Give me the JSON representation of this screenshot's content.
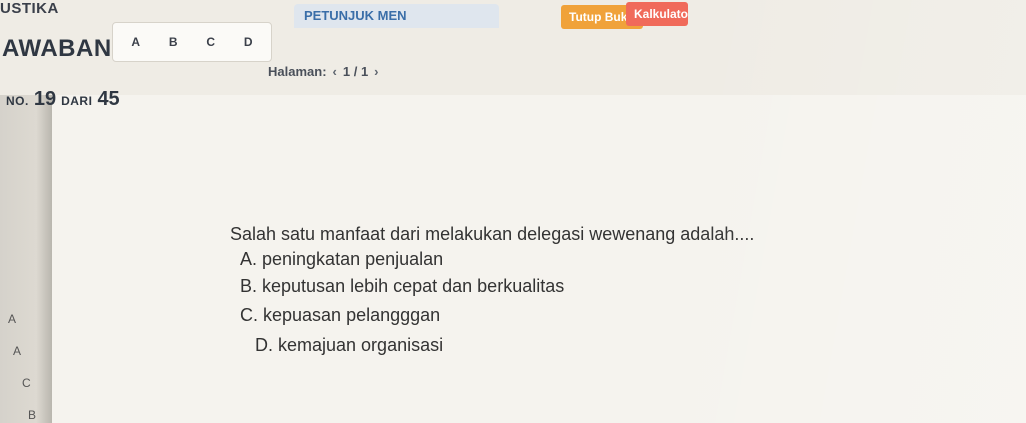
{
  "header": {
    "app_title": "USTIKA",
    "answer_label": "AWABAN:",
    "answer_tabs": [
      "A",
      "B",
      "C",
      "D"
    ],
    "petunjuk_tab": "PETUNJUK MEN",
    "tutup_buku": "Tutup Buku",
    "kalkulator": "Kalkulato"
  },
  "pager": {
    "label": "Halaman:",
    "prev": "‹",
    "page": "1 / 1",
    "next": "›"
  },
  "question_number": {
    "prefix": "NO.",
    "current": "19",
    "of": "DARI",
    "total": "45"
  },
  "question": {
    "text": "Salah satu manfaat dari melakukan delegasi wewenang adalah....",
    "options": [
      "A.  peningkatan penjualan",
      "B.  keputusan lebih cepat dan berkualitas",
      "C.  kepuasan pelangggan",
      "D.  kemajuan organisasi"
    ]
  },
  "side_answers": [
    "A",
    "A",
    "C",
    "B"
  ]
}
